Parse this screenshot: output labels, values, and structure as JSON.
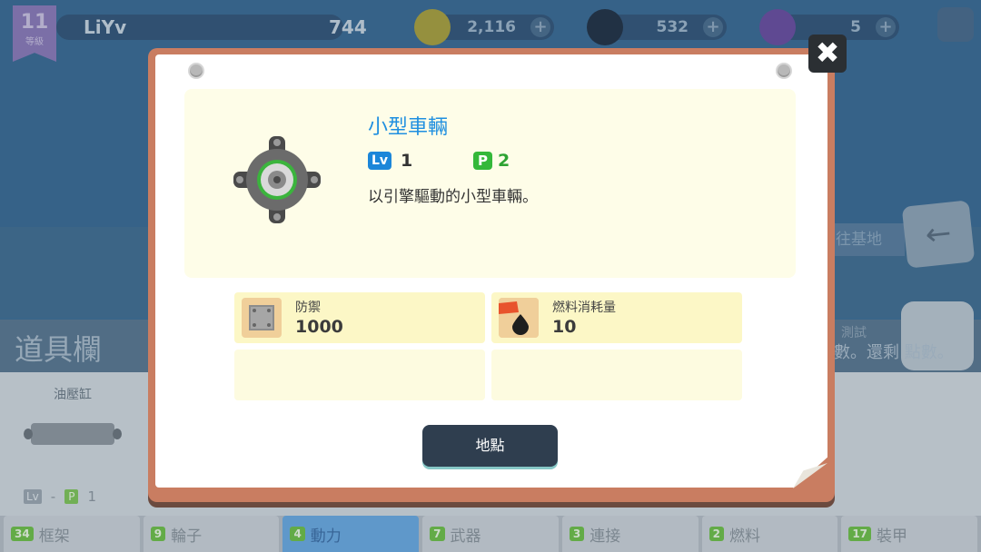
{
  "header": {
    "level": "11",
    "level_label": "等級",
    "player_name": "LiYv",
    "points": "744",
    "coins": "2,116",
    "oil": "532",
    "gems": "5"
  },
  "side": {
    "goto_base": "往基地",
    "note_top": "測試",
    "note": "數。還剩 點數。"
  },
  "panel": {
    "title": "道具欄",
    "item_name": "油壓缸",
    "item_lv": "-",
    "item_p": "1"
  },
  "tabs": [
    {
      "count": "34",
      "label": "框架"
    },
    {
      "count": "9",
      "label": "輪子"
    },
    {
      "count": "4",
      "label": "動力"
    },
    {
      "count": "7",
      "label": "武器"
    },
    {
      "count": "3",
      "label": "連接"
    },
    {
      "count": "2",
      "label": "燃料"
    },
    {
      "count": "17",
      "label": "裝甲"
    }
  ],
  "modal": {
    "close": "✖",
    "part_name": "小型車輛",
    "lv_badge": "Lv",
    "lv_value": "1",
    "p_badge": "P",
    "p_value": "2",
    "description": "以引擎驅動的小型車輛。",
    "stats": [
      {
        "label": "防禦",
        "value": "1000"
      },
      {
        "label": "燃料消耗量",
        "value": "10"
      }
    ],
    "place_button": "地點"
  },
  "colors": {
    "accent_blue": "#1f8fe0",
    "p_green": "#34b83a",
    "frame": "#c97d61",
    "button_dark": "#2f3e4f"
  }
}
